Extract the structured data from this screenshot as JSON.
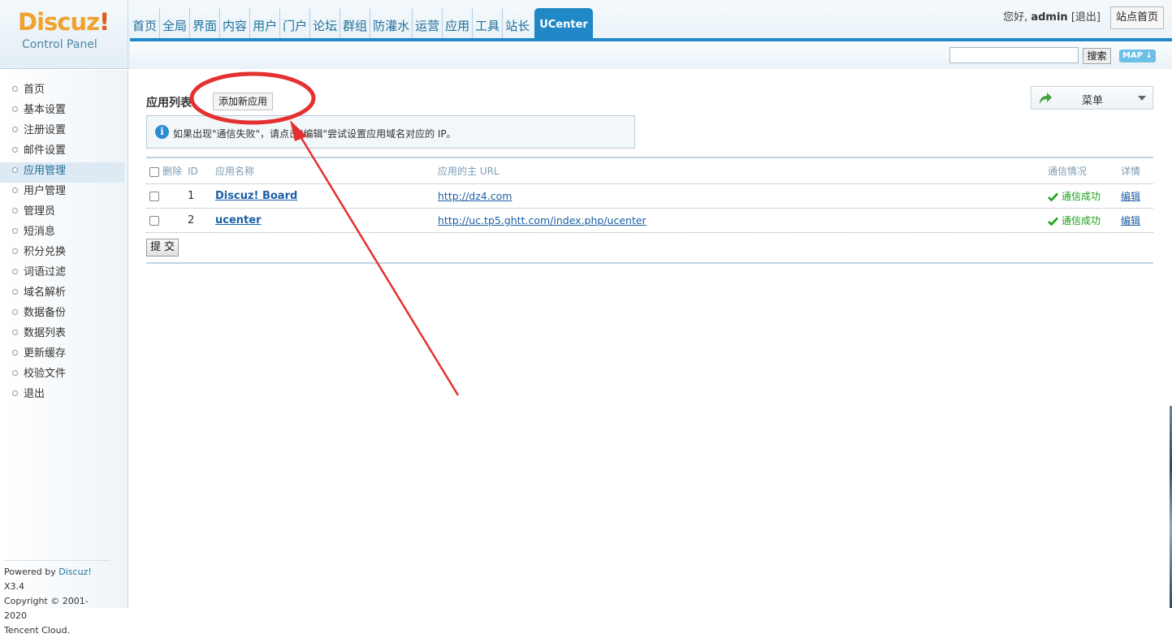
{
  "logo": {
    "brand": "Discuz",
    "brand_excl": "!",
    "subtitle": "Control Panel"
  },
  "nav": {
    "items": [
      "首页",
      "全局",
      "界面",
      "内容",
      "用户",
      "门户",
      "论坛",
      "群组",
      "防灌水",
      "运营",
      "应用",
      "工具",
      "站长"
    ],
    "active": "UCenter"
  },
  "user": {
    "greeting_prefix": "您好, ",
    "username": "admin",
    "logout": "[退出]",
    "site_home": "站点首页"
  },
  "search": {
    "value": "",
    "button": "搜索",
    "map_button": "MAP ↓"
  },
  "sidebar": {
    "items": [
      {
        "label": "首页"
      },
      {
        "label": "基本设置"
      },
      {
        "label": "注册设置"
      },
      {
        "label": "邮件设置"
      },
      {
        "label": "应用管理",
        "current": true
      },
      {
        "label": "用户管理"
      },
      {
        "label": "管理员"
      },
      {
        "label": "短消息"
      },
      {
        "label": "积分兑换"
      },
      {
        "label": "词语过滤"
      },
      {
        "label": "域名解析"
      },
      {
        "label": "数据备份"
      },
      {
        "label": "数据列表"
      },
      {
        "label": "更新缓存"
      },
      {
        "label": "校验文件"
      },
      {
        "label": "退出"
      }
    ],
    "copyright": {
      "line1_prefix": "Powered by ",
      "line1_brand": "Discuz!",
      "line1_version": " X3.4",
      "line2": "Copyright © 2001-2020",
      "line3": "Tencent Cloud."
    }
  },
  "main": {
    "title": "应用列表",
    "add_button": "添加新应用",
    "menu_label": "菜单",
    "tip": "如果出现\"通信失败\"，请点击\"编辑\"尝试设置应用域名对应的 IP。",
    "table": {
      "headers": {
        "delete": "删除",
        "id": "ID",
        "name": "应用名称",
        "url": "应用的主 URL",
        "status": "通信情况",
        "detail": "详情"
      },
      "rows": [
        {
          "id": "1",
          "name": "Discuz! Board",
          "url": "http://dz4.com",
          "status": "通信成功",
          "edit": "编辑"
        },
        {
          "id": "2",
          "name": "ucenter",
          "url": "http://uc.tp5.ghtt.com/index.php/ucenter",
          "status": "通信成功",
          "edit": "编辑"
        }
      ]
    },
    "submit": "提 交"
  },
  "colors": {
    "accent": "#2188c7",
    "brand_orange": "#f0a22e",
    "success_green": "#19a319",
    "annotation_red": "#e53030"
  }
}
